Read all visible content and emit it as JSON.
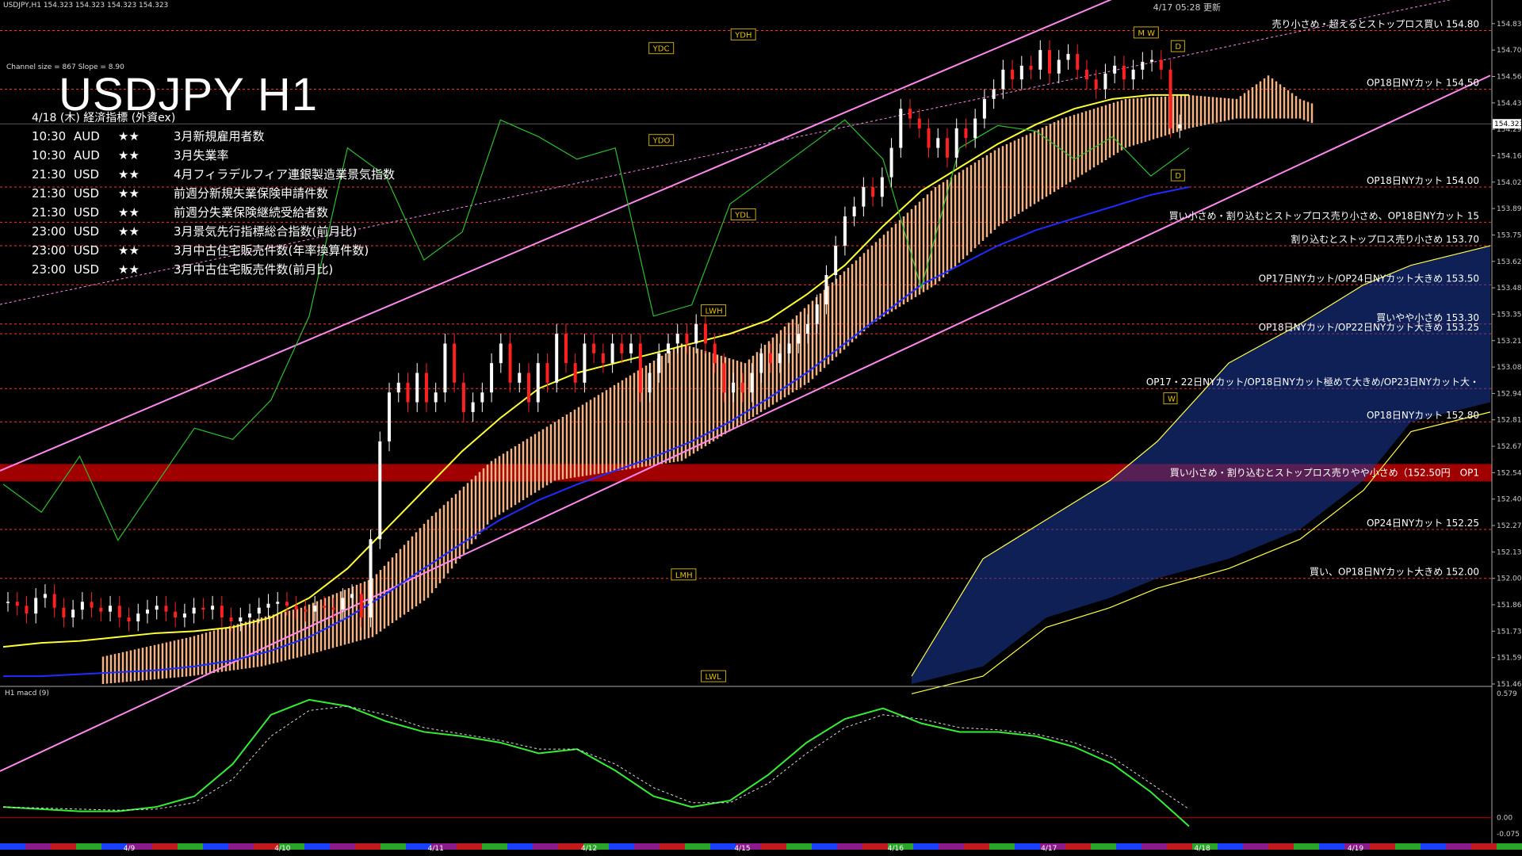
{
  "window_title": "USDJPY,H1  154.323 154.323 154.323 154.323",
  "big_title": "USDJPY H1",
  "channel_info": "Channel size = 867 Slope = 8.90",
  "top_right_timestamp": "4/17 05:28 更新",
  "calendar": {
    "header": "4/18 (木) 経済指標 (外資ex)",
    "rows": [
      {
        "time": "10:30",
        "currency": "AUD",
        "stars": "★★",
        "event": "3月新規雇用者数"
      },
      {
        "time": "10:30",
        "currency": "AUD",
        "stars": "★★",
        "event": "3月失業率"
      },
      {
        "time": "21:30",
        "currency": "USD",
        "stars": "★★",
        "event": "4月フィラデルフィア連銀製造業景気指数"
      },
      {
        "time": "21:30",
        "currency": "USD",
        "stars": "★★",
        "event": "前週分新規失業保険申請件数"
      },
      {
        "time": "21:30",
        "currency": "USD",
        "stars": "★★",
        "event": "前週分失業保険継続受給者数"
      },
      {
        "time": "23:00",
        "currency": "USD",
        "stars": "★★",
        "event": "3月景気先行指標総合指数(前月比)"
      },
      {
        "time": "23:00",
        "currency": "USD",
        "stars": "★★",
        "event": "3月中古住宅販売件数(年率換算件数)"
      },
      {
        "time": "23:00",
        "currency": "USD",
        "stars": "★★",
        "event": "3月中古住宅販売件数(前月比)"
      }
    ]
  },
  "colors": {
    "background": "#000000",
    "bull_candle": "#ffffff",
    "bear_candle": "#ff2020",
    "cloud": "#f4b183",
    "blue_cloud": "#1a3a9a",
    "ma_yellow": "#ffff33",
    "ma_blue": "#1e2cff",
    "channel": "#ff88ee",
    "order_line": "#ff3030",
    "rsi_green": "#2bbf2b",
    "macd_green": "#33ee33",
    "zone": "#a00000",
    "zone_text": "#ffffff"
  },
  "chart_data": {
    "type": "candlestick",
    "symbol": "USDJPY",
    "timeframe": "H1",
    "current_price": "154.323",
    "ylim": [
      151.46,
      154.81
    ],
    "y_ticks": [
      "154.835",
      "154.700",
      "154.565",
      "154.430",
      "154.295",
      "154.160",
      "154.025",
      "153.890",
      "153.755",
      "153.620",
      "153.485",
      "153.350",
      "153.215",
      "153.080",
      "152.945",
      "152.810",
      "152.675",
      "152.540",
      "152.405",
      "152.270",
      "152.135",
      "152.000",
      "151.865",
      "151.730",
      "151.595",
      "151.460"
    ],
    "x_ticks": [
      "4/9",
      "4/10",
      "4/11",
      "4/12",
      "4/15",
      "4/16",
      "4/17",
      "4/18",
      "4/19"
    ],
    "order_levels": [
      {
        "price": 154.8,
        "label": "売り小さめ・超えるとストップロス買い 154.80"
      },
      {
        "price": 154.5,
        "label": "OP18日NYカット 154.50"
      },
      {
        "price": 154.0,
        "label": "OP18日NYカット 154.00"
      },
      {
        "price": 153.82,
        "label": "買い小さめ・割り込むとストップロス売り小さめ、OP18日NYカット 15"
      },
      {
        "price": 153.7,
        "label": "割り込むとストップロス売り小さめ 153.70"
      },
      {
        "price": 153.5,
        "label": "OP17日NYカット/OP24日NYカット大きめ 153.50"
      },
      {
        "price": 153.3,
        "label": "買いやや小さめ 153.30"
      },
      {
        "price": 153.25,
        "label": "OP18日NYカット/OP22日NYカット大きめ 153.25"
      },
      {
        "price": 152.97,
        "label": "OP17・22日NYカット/OP18日NYカット極めて大きめ/OP23日NYカット大・"
      },
      {
        "price": 152.8,
        "label": "OP18日NYカット 152.80"
      },
      {
        "price": 152.54,
        "label": "買い小さめ・割り込むとストップロス売りやや小さめ（152.50円　OP1",
        "zone": true
      },
      {
        "price": 152.25,
        "label": "OP24日NYカット 152.25"
      },
      {
        "price": 152.0,
        "label": "買い、OP18日NYカット大きめ 152.00"
      }
    ],
    "boxed_labels": [
      {
        "text": "YDH",
        "price": 154.78,
        "x_frac": 0.49
      },
      {
        "text": "YDC",
        "price": 154.71,
        "x_frac": 0.435
      },
      {
        "text": "YDO",
        "price": 154.24,
        "x_frac": 0.435
      },
      {
        "text": "YDL",
        "price": 153.86,
        "x_frac": 0.49
      },
      {
        "text": "LWH",
        "price": 153.37,
        "x_frac": 0.47
      },
      {
        "text": "LMH",
        "price": 152.02,
        "x_frac": 0.45
      },
      {
        "text": "LWL",
        "price": 151.5,
        "x_frac": 0.47
      },
      {
        "text": "M W",
        "price": 154.79,
        "x_frac": 0.76
      },
      {
        "text": "D",
        "price": 154.72,
        "x_frac": 0.785
      },
      {
        "text": "D",
        "price": 154.06,
        "x_frac": 0.785
      },
      {
        "text": "W",
        "price": 152.92,
        "x_frac": 0.78
      }
    ],
    "close_series": [
      151.88,
      151.86,
      151.82,
      151.9,
      151.92,
      151.85,
      151.8,
      151.84,
      151.88,
      151.85,
      151.83,
      151.86,
      151.8,
      151.78,
      151.82,
      151.84,
      151.86,
      151.83,
      151.8,
      151.82,
      151.85,
      151.84,
      151.86,
      151.8,
      151.78,
      151.8,
      151.82,
      151.85,
      151.87,
      151.88,
      151.86,
      151.84,
      151.83,
      151.86,
      151.85,
      151.84,
      151.9,
      151.92,
      151.8,
      152.2,
      152.7,
      152.95,
      153.0,
      152.9,
      153.05,
      152.9,
      152.95,
      153.2,
      153.0,
      152.85,
      152.9,
      152.95,
      153.1,
      153.2,
      153.0,
      153.05,
      152.9,
      153.1,
      153.0,
      153.25,
      153.1,
      153.0,
      153.2,
      153.15,
      153.1,
      153.2,
      153.15,
      153.2,
      152.95,
      153.05,
      153.15,
      153.2,
      153.25,
      153.2,
      153.3,
      153.2,
      153.1,
      152.95,
      153.0,
      152.95,
      153.05,
      153.15,
      153.1,
      153.15,
      153.2,
      153.25,
      153.3,
      153.4,
      153.55,
      153.7,
      153.85,
      153.9,
      154.0,
      153.95,
      154.05,
      154.2,
      154.4,
      154.35,
      154.3,
      154.2,
      154.25,
      154.15,
      154.3,
      154.25,
      154.35,
      154.45,
      154.5,
      154.6,
      154.55,
      154.62,
      154.6,
      154.7,
      154.58,
      154.65,
      154.68,
      154.6,
      154.55,
      154.5,
      154.58,
      154.62,
      154.55,
      154.6,
      154.64,
      154.65,
      154.6,
      154.3,
      154.32
    ],
    "ma_yellow": [
      151.65,
      151.67,
      151.68,
      151.7,
      151.72,
      151.73,
      151.75,
      151.8,
      151.9,
      152.05,
      152.25,
      152.45,
      152.65,
      152.82,
      152.97,
      153.05,
      153.1,
      153.15,
      153.2,
      153.25,
      153.32,
      153.45,
      153.6,
      153.8,
      153.98,
      154.1,
      154.22,
      154.32,
      154.4,
      154.45,
      154.47,
      154.47
    ],
    "ma_blue": [
      151.5,
      151.5,
      151.51,
      151.52,
      151.53,
      151.55,
      151.58,
      151.63,
      151.7,
      151.8,
      151.92,
      152.05,
      152.18,
      152.3,
      152.4,
      152.48,
      152.55,
      152.62,
      152.7,
      152.8,
      152.92,
      153.05,
      153.2,
      153.35,
      153.5,
      153.6,
      153.7,
      153.78,
      153.84,
      153.9,
      153.96,
      154.0
    ],
    "macd": {
      "label": "H1  macd (9)",
      "ylim": [
        -0.075,
        0.579
      ],
      "y_ticks": [
        "0.579",
        "0.00",
        "-0.075"
      ],
      "main": [
        0.05,
        0.04,
        0.03,
        0.03,
        0.05,
        0.1,
        0.25,
        0.48,
        0.55,
        0.52,
        0.45,
        0.4,
        0.38,
        0.35,
        0.3,
        0.32,
        0.22,
        0.1,
        0.05,
        0.08,
        0.2,
        0.35,
        0.46,
        0.51,
        0.44,
        0.4,
        0.4,
        0.38,
        0.33,
        0.25,
        0.12,
        -0.04
      ],
      "signal": [
        0.05,
        0.045,
        0.04,
        0.035,
        0.04,
        0.07,
        0.18,
        0.38,
        0.5,
        0.52,
        0.48,
        0.42,
        0.39,
        0.36,
        0.32,
        0.32,
        0.25,
        0.14,
        0.07,
        0.07,
        0.16,
        0.3,
        0.42,
        0.48,
        0.46,
        0.42,
        0.41,
        0.39,
        0.35,
        0.28,
        0.16,
        0.04
      ]
    }
  }
}
